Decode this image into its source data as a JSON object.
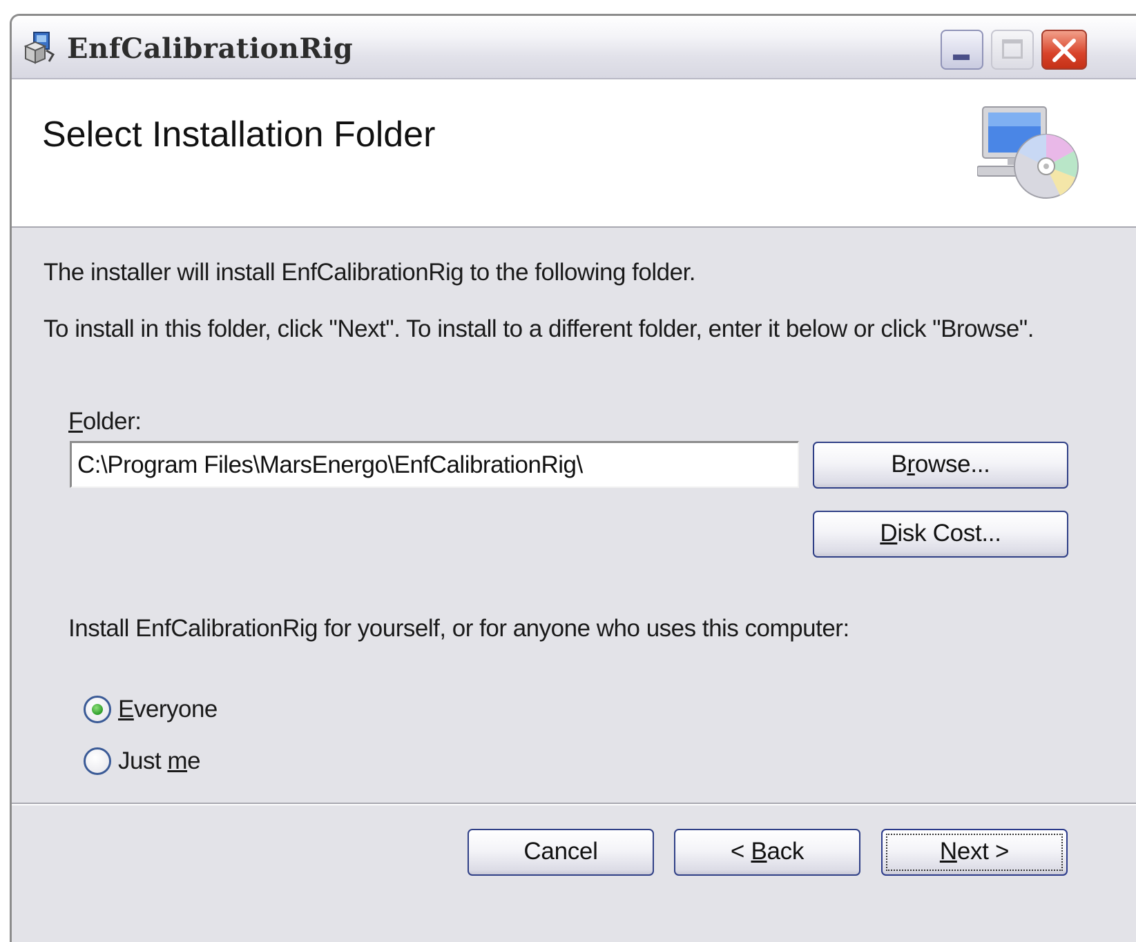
{
  "window": {
    "title": "EnfCalibrationRig",
    "controls": {
      "minimize": "minimize",
      "maximize": "maximize",
      "close": "close"
    }
  },
  "banner": {
    "title": "Select Installation Folder",
    "icon": "computer-disc-icon"
  },
  "body": {
    "intro": "The installer will install EnfCalibrationRig to the following folder.",
    "instructions": "To install in this folder, click \"Next\". To install to a different folder, enter it below or click \"Browse\".",
    "folder_label_accel": "F",
    "folder_label_rest": "older:",
    "folder_value": "C:\\Program Files\\MarsEnergo\\EnfCalibrationRig\\",
    "install_for": "Install EnfCalibrationRig for yourself, or for anyone who uses this computer:"
  },
  "buttons": {
    "browse_pre": "B",
    "browse_accel": "r",
    "browse_post": "owse...",
    "disk_accel": "D",
    "disk_post": "isk Cost...",
    "cancel": "Cancel",
    "back_pre": "< ",
    "back_accel": "B",
    "back_post": "ack",
    "next_accel": "N",
    "next_post": "ext >"
  },
  "radio": {
    "everyone_accel": "E",
    "everyone_post": "veryone",
    "justme_pre": "Just ",
    "justme_accel": "m",
    "justme_post": "e",
    "selected": "everyone"
  },
  "colors": {
    "window_bg": "#e3e3e8",
    "button_border": "#2f3f86",
    "close_red": "#d8432a"
  }
}
